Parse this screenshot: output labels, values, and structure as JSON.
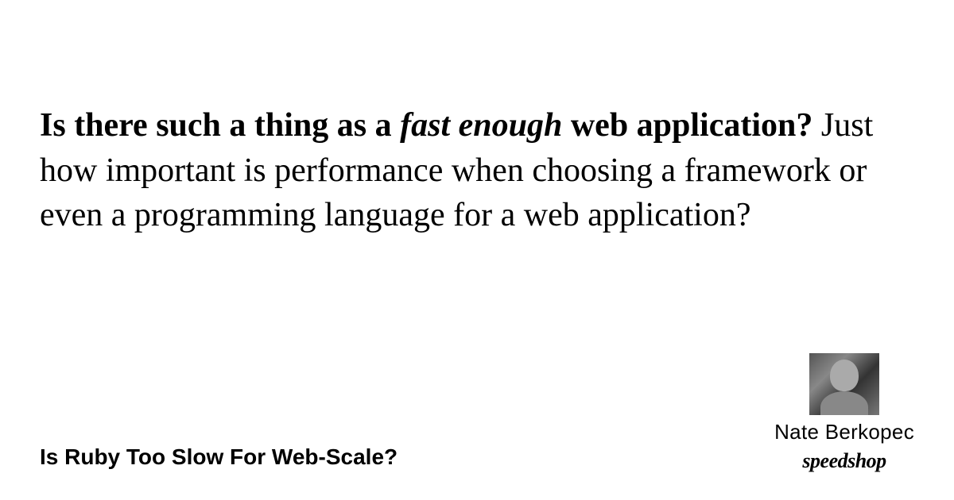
{
  "main": {
    "question_prefix": "Is there such a thing as a ",
    "emphasis": "fast enough",
    "question_suffix": " web application?",
    "body": " Just how important is performance when choosing a framework or even a programming language for a web application?"
  },
  "footer": {
    "title": "Is Ruby Too Slow For Web-Scale?",
    "author": "Nate Berkopec",
    "brand": "speedshop"
  }
}
